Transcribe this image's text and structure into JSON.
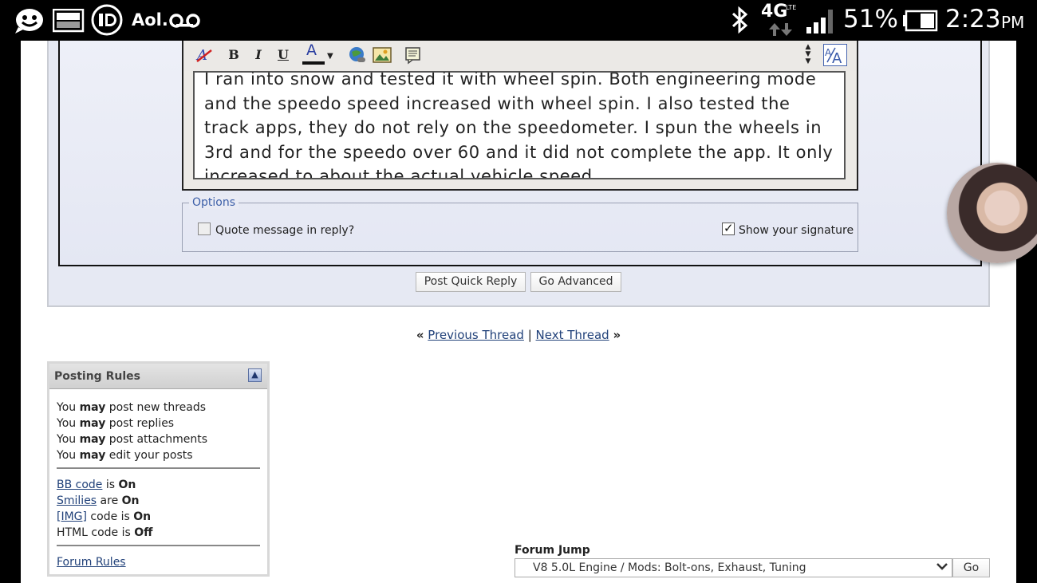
{
  "status_bar": {
    "carrier_app": "Aol.",
    "network": "4G",
    "network_sub": "LTE",
    "battery": "51%",
    "time": "2:23",
    "ampm": "PM"
  },
  "editor": {
    "text": "I ran into snow and tested it with wheel spin. Both engineering mode and the speedo speed increased with wheel spin. I also tested the track apps, they do not rely on the speedometer. I spun the wheels in 3rd and for the speedo over 60 and it did not complete the app. It only increased to about the actual vehicle speed.",
    "toolbar": {
      "bold": "B",
      "italic": "I",
      "underline": "U",
      "font_color": "A"
    }
  },
  "options": {
    "legend": "Options",
    "quote_label": "Quote message in reply?",
    "quote_checked": false,
    "signature_label": "Show your signature",
    "signature_checked": true
  },
  "buttons": {
    "post_quick_reply": "Post Quick Reply",
    "go_advanced": "Go Advanced"
  },
  "thread_nav": {
    "prev_arrow": "«",
    "previous": "Previous Thread",
    "separator": "|",
    "next": "Next Thread",
    "next_arrow": "»"
  },
  "posting_rules": {
    "title": "Posting Rules",
    "permissions": [
      {
        "pre": "You ",
        "bold": "may",
        "post": " post new threads"
      },
      {
        "pre": "You ",
        "bold": "may",
        "post": " post replies"
      },
      {
        "pre": "You ",
        "bold": "may",
        "post": " post attachments"
      },
      {
        "pre": "You ",
        "bold": "may",
        "post": " edit your posts"
      }
    ],
    "codes": {
      "bb_link": "BB code",
      "bb_mid": " is ",
      "bb_state": "On",
      "smilies_link": "Smilies",
      "smilies_mid": " are ",
      "smilies_state": "On",
      "img_link": "[IMG]",
      "img_mid": " code is ",
      "img_state": "On",
      "html_pre": "HTML code is ",
      "html_state": "Off"
    },
    "forum_rules": "Forum Rules"
  },
  "forum_jump": {
    "label": "Forum Jump",
    "selected": "V8 5.0L Engine / Mods: Bolt-ons, Exhaust, Tuning",
    "go": "Go"
  }
}
